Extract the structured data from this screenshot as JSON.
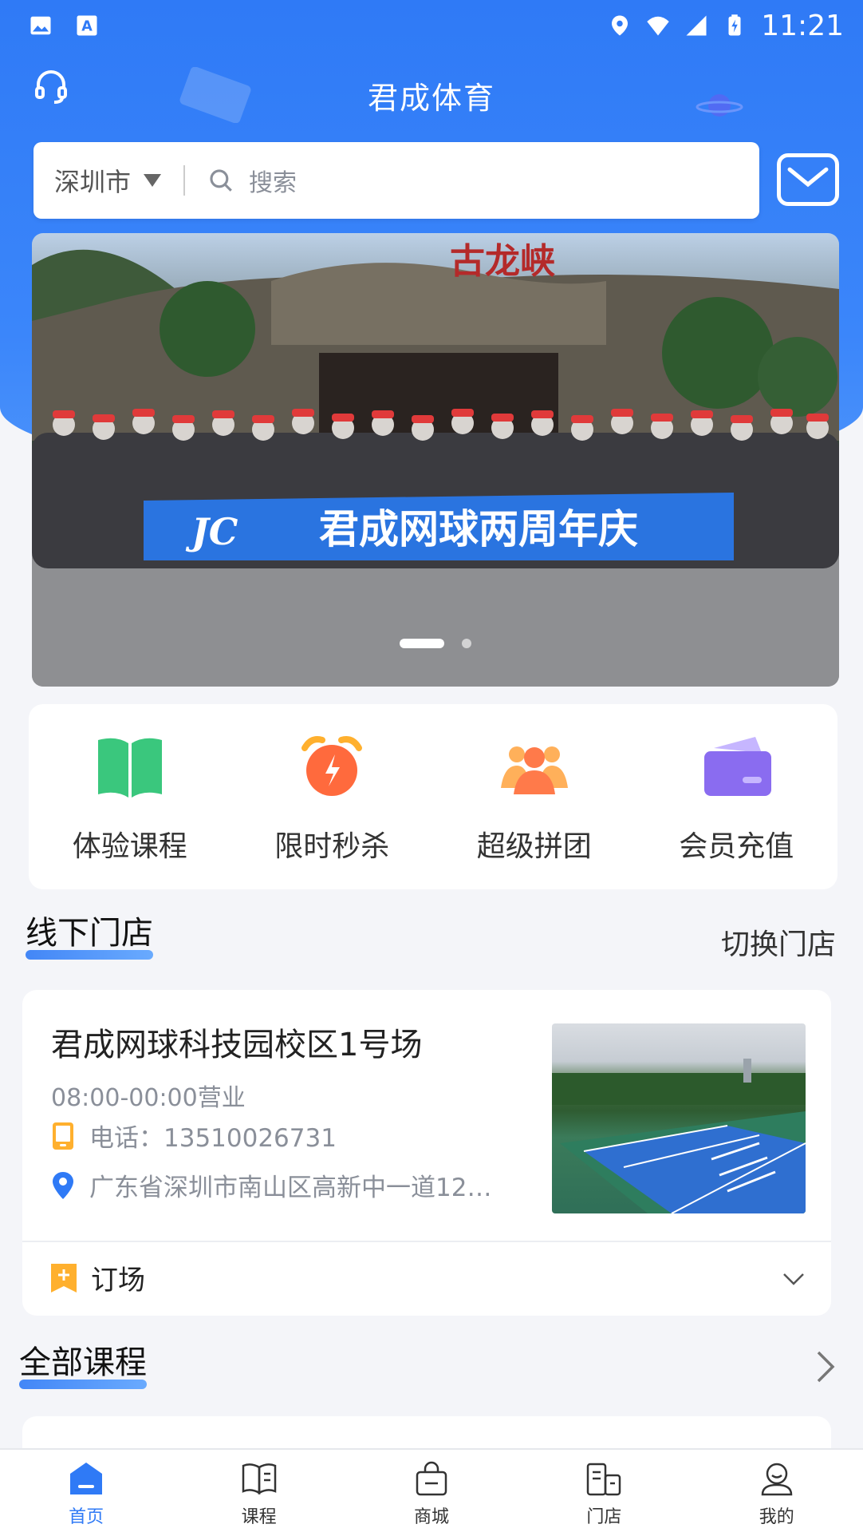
{
  "status": {
    "time": "11:21"
  },
  "header": {
    "title": "君成体育"
  },
  "search": {
    "city": "深圳市",
    "placeholder": "搜索"
  },
  "banner": {
    "text": "君成网球两周年庆",
    "logo": "JC",
    "sign": "古龙峡"
  },
  "quick": [
    {
      "label": "体验课程",
      "icon": "book-icon",
      "color": "#3ac77d"
    },
    {
      "label": "限时秒杀",
      "icon": "alarm-clock-icon",
      "color": "#ff6a3d"
    },
    {
      "label": "超级拼团",
      "icon": "group-icon",
      "color": "#ff8a4d"
    },
    {
      "label": "会员充值",
      "icon": "card-icon",
      "color": "#8a6cf0"
    }
  ],
  "stores_section": {
    "title": "线下门店",
    "switch_label": "切换门店"
  },
  "store": {
    "name": "君成网球科技园校区1号场",
    "hours": "08:00-00:00营业",
    "phone": "电话：13510026731",
    "address": "广东省深圳市南山区高新中一道12…",
    "book_label": "订场"
  },
  "courses_section": {
    "title": "全部课程"
  },
  "tabs": [
    {
      "label": "首页",
      "active": true
    },
    {
      "label": "课程",
      "active": false
    },
    {
      "label": "商城",
      "active": false
    },
    {
      "label": "门店",
      "active": false
    },
    {
      "label": "我的",
      "active": false
    }
  ],
  "colors": {
    "primary": "#2f7af6",
    "bg": "#f4f5f9"
  }
}
